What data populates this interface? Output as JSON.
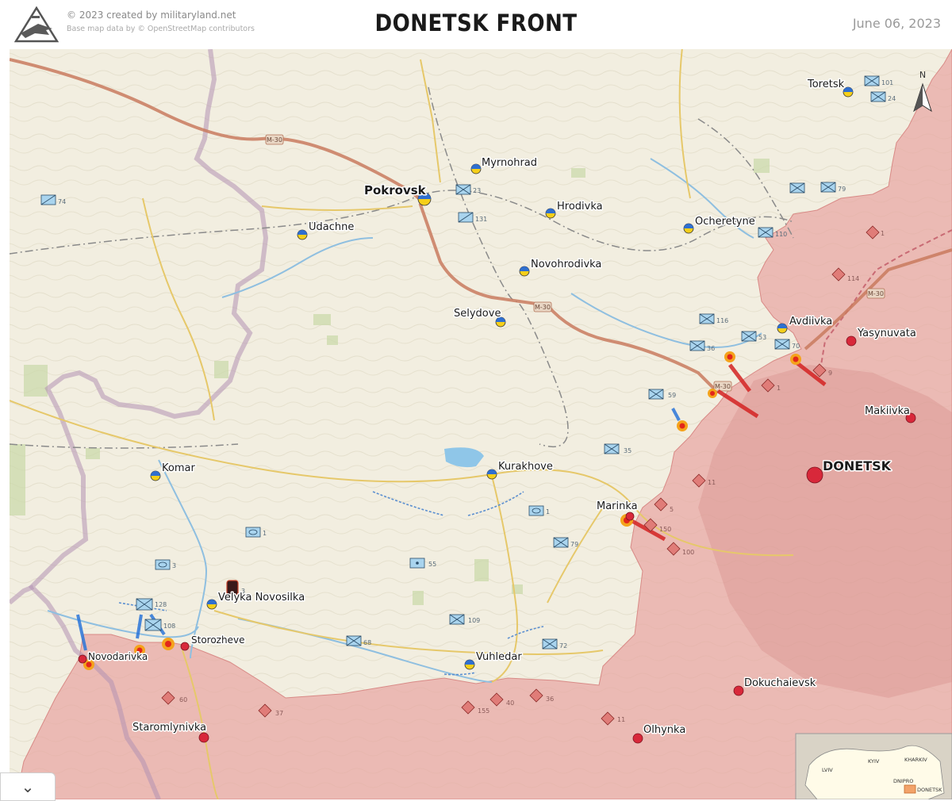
{
  "header": {
    "credit": "© 2023 created by militaryland.net",
    "basemap_credit": "Base map data by © OpenStreetMap contributors",
    "title": "DONETSK FRONT",
    "date": "June 06, 2023"
  },
  "compass": {
    "label": "N"
  },
  "colors": {
    "ukraine_flag_top": "#2f6fd0",
    "ukraine_flag_bottom": "#f5cf1a",
    "russian_control": "#e8a6a2",
    "russian_town": "#d8283a",
    "highway": "#c97a5e",
    "unit_ua": "#a9d4ee",
    "unit_ru": "#e07c78",
    "attack_arrow_ru": "#d42222",
    "attack_arrow_ua": "#2a74d8"
  },
  "places": {
    "ukraine": [
      {
        "name": "Toretsk",
        "bold": false
      },
      {
        "name": "Myrnohrad",
        "bold": false
      },
      {
        "name": "Pokrovsk",
        "bold": true
      },
      {
        "name": "Hrodivka",
        "bold": false
      },
      {
        "name": "Udachne",
        "bold": false
      },
      {
        "name": "Ocheretyne",
        "bold": false
      },
      {
        "name": "Novohrodivka",
        "bold": false
      },
      {
        "name": "Selydove",
        "bold": false
      },
      {
        "name": "Avdiivka",
        "bold": false
      },
      {
        "name": "Komar",
        "bold": false
      },
      {
        "name": "Kurakhove",
        "bold": false
      },
      {
        "name": "Velyka Novosilka",
        "bold": false
      },
      {
        "name": "Vuhledar",
        "bold": false
      }
    ],
    "russia": [
      {
        "name": "Yasynuvata",
        "bold": false
      },
      {
        "name": "Makiivka",
        "bold": false
      },
      {
        "name": "DONETSK",
        "bold": true
      },
      {
        "name": "Marinka",
        "bold": false
      },
      {
        "name": "Novodarivka",
        "bold": false
      },
      {
        "name": "Storozheve",
        "bold": false
      },
      {
        "name": "Dokuchaievsk",
        "bold": false
      },
      {
        "name": "Staromlynivka",
        "bold": false
      },
      {
        "name": "Olhynka",
        "bold": false
      }
    ]
  },
  "road_labels": [
    "M-30",
    "M-30",
    "M-30",
    "M-30"
  ],
  "units": {
    "ukraine": [
      "101",
      "24",
      "23",
      "131",
      "74",
      "79",
      "110",
      "116",
      "53",
      "36",
      "70",
      "59",
      "35",
      "1",
      "79",
      "1",
      "3",
      "55",
      "128",
      "108",
      "3",
      "109",
      "68",
      "72"
    ],
    "russia": [
      "1",
      "114",
      "9",
      "1",
      "11",
      "5",
      "150",
      "100",
      "60",
      "37",
      "155",
      "40",
      "36",
      "11"
    ]
  },
  "inset": {
    "labels": [
      "LVIV",
      "KYIV",
      "KHARKIV",
      "DNIPRO",
      "DONETSK"
    ]
  },
  "ui": {
    "collapse_icon": "⌄"
  }
}
